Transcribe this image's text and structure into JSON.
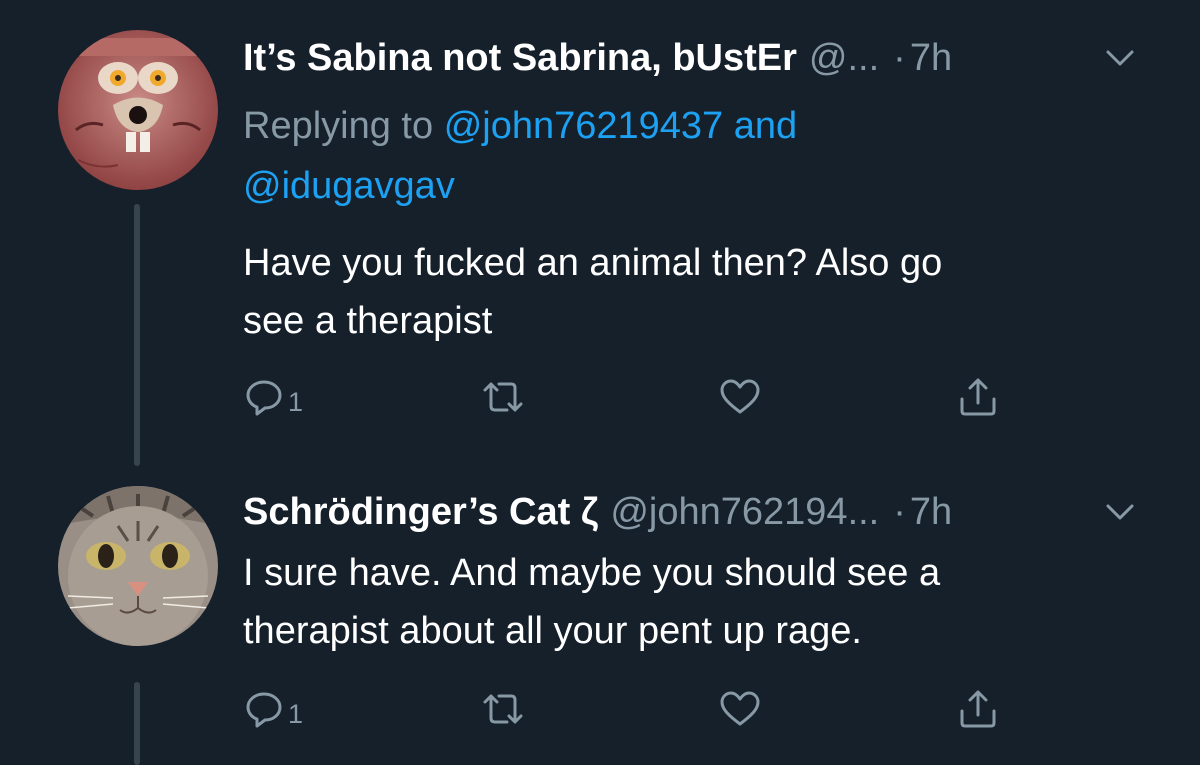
{
  "tweets": [
    {
      "display_name": "It’s Sabina not Sabrina, bUstEr",
      "handle": "@...",
      "separator": "·",
      "time": "7h",
      "replying_prefix": "Replying to",
      "replying_handle_1": "@john76219437",
      "replying_and": "and",
      "replying_handle_2": "@idugavgav",
      "text_line_1": "Have you fucked an animal then? Also go",
      "text_line_2": "see a therapist",
      "reply_count": "1"
    },
    {
      "display_name": "Schrödinger’s Cat ζ",
      "handle": "@john762194...",
      "separator": "·",
      "time": "7h",
      "text_line_1": "I sure have. And maybe you should see a",
      "text_line_2": "therapist about all your pent up rage.",
      "reply_count": "1"
    }
  ],
  "icons": {
    "reply": "reply-icon",
    "retweet": "retweet-icon",
    "like": "heart-icon",
    "share": "share-icon",
    "more": "chevron-down-icon"
  },
  "colors": {
    "background": "#15202b",
    "secondary_text": "#8899a6",
    "link": "#1da1f2",
    "thread_line": "#38444d"
  }
}
